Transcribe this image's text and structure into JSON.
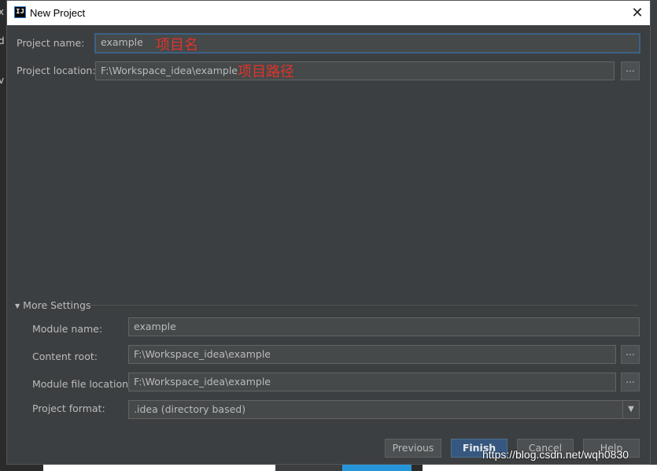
{
  "window": {
    "title": "New Project",
    "icon": "IJ"
  },
  "project": {
    "name_label": "Project name:",
    "name_value": "example",
    "name_annotation": "项目名",
    "location_label": "Project location:",
    "location_value": "F:\\Workspace_idea\\example",
    "location_annotation": "项目路径",
    "browse_label": "..."
  },
  "more_settings": {
    "label": "More Settings",
    "module_name_label": "Module name:",
    "module_name_value": "example",
    "content_root_label": "Content root:",
    "content_root_value": "F:\\Workspace_idea\\example",
    "module_file_label": "Module file location:",
    "module_file_value": "F:\\Workspace_idea\\example",
    "format_label": "Project format:",
    "format_value": ".idea (directory based)",
    "browse_label": "..."
  },
  "buttons": {
    "previous": "Previous",
    "finish": "Finish",
    "cancel": "Cancel",
    "help": "Help"
  },
  "watermark": "https://blog.csdn.net/wqh0830",
  "colors": {
    "background": "#3c3f41",
    "field": "#45494a",
    "focus_border": "#3d6185",
    "annotation": "#e0342b",
    "primary_button": "#365880"
  }
}
